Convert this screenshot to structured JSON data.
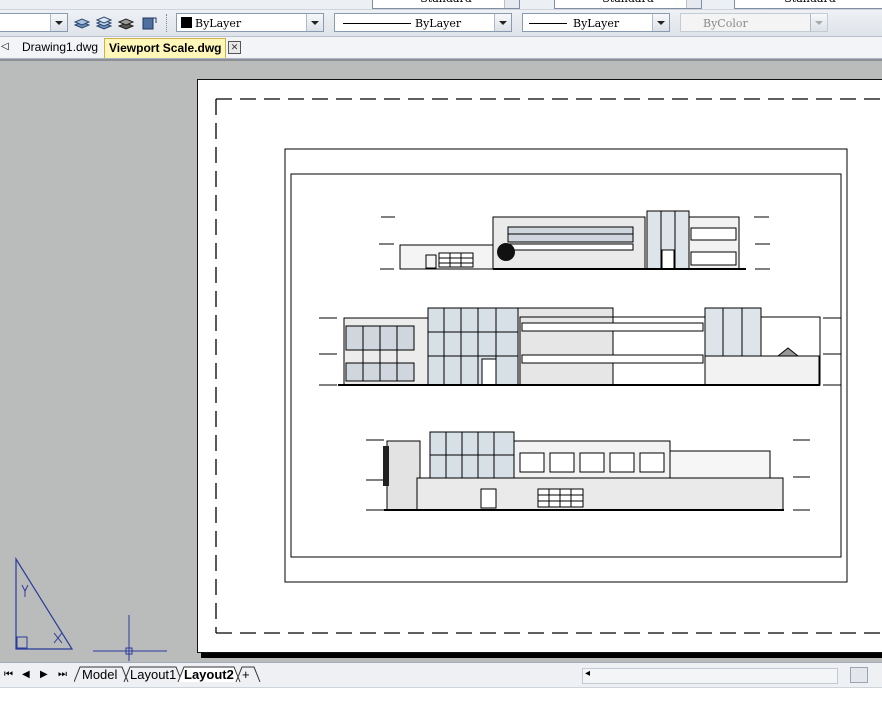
{
  "top_toolbar": {
    "text_style": "Standard",
    "dim_style": "Standard",
    "table_style": "Standard"
  },
  "properties_toolbar": {
    "color": "ByLayer",
    "linetype": "ByLayer",
    "lineweight": "ByLayer",
    "plot_style": "ByColor"
  },
  "document_tabs": [
    {
      "label": "Drawing1.dwg",
      "active": false
    },
    {
      "label": "Viewport Scale.dwg",
      "active": true
    }
  ],
  "layout_tabs": [
    {
      "label": "Model",
      "active": false
    },
    {
      "label": "Layout1",
      "active": false
    },
    {
      "label": "Layout2",
      "active": true
    },
    {
      "label": "+",
      "active": false
    }
  ],
  "icons": {
    "doc_tab_close": "close-icon",
    "ucs": "ucs-triangle-icon",
    "crosshair": "crosshair-cursor-icon",
    "layer_buttons": [
      "layer-states-icon",
      "layer-previous-icon",
      "layer-isolate-icon",
      "match-layer-icon"
    ]
  },
  "colors": {
    "active_tab": "#fff7b8",
    "canvas_bg": "#babcbc",
    "ucs": "#2a3a9a"
  }
}
